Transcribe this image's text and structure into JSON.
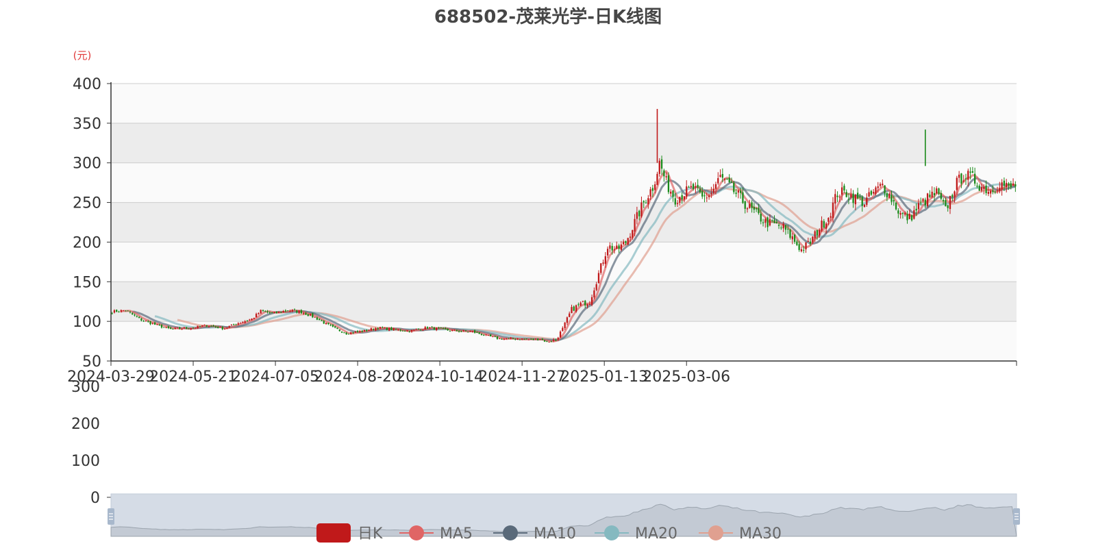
{
  "chart_data": {
    "type": "candlestick",
    "title": "688502-茂莱光学-日K线图",
    "y_unit": "(元)",
    "ylim": [
      50,
      400
    ],
    "y_ticks": [
      400,
      350,
      300,
      250,
      200,
      150,
      100,
      50
    ],
    "x_tick_labels": [
      "2024-03-29",
      "2024-05-21",
      "2024-07-05",
      "2024-08-20",
      "2024-10-14",
      "2024-11-27",
      "2025-01-13",
      "2025-03-06"
    ],
    "volume_ticks": [
      300,
      200,
      100,
      0
    ],
    "legend": [
      "日K",
      "MA5",
      "MA10",
      "MA20",
      "MA30"
    ],
    "colors": {
      "up": "#c0191a",
      "down": "#1a8a1a",
      "ma5": "#e06565",
      "ma10": "#5a6a7a",
      "ma20": "#85b9c0",
      "ma30": "#e0a090",
      "grid_band": "#ececec",
      "zoom_fill": "#d5dce6",
      "zoom_handle": "#a8b8cc"
    },
    "close_trend": [
      [
        0,
        112
      ],
      [
        6,
        114
      ],
      [
        12,
        103
      ],
      [
        20,
        95
      ],
      [
        26,
        90
      ],
      [
        36,
        92
      ],
      [
        42,
        95
      ],
      [
        50,
        91
      ],
      [
        56,
        98
      ],
      [
        62,
        103
      ],
      [
        66,
        113
      ],
      [
        72,
        110
      ],
      [
        78,
        114
      ],
      [
        84,
        112
      ],
      [
        90,
        105
      ],
      [
        98,
        92
      ],
      [
        104,
        85
      ],
      [
        112,
        88
      ],
      [
        118,
        92
      ],
      [
        124,
        90
      ],
      [
        132,
        88
      ],
      [
        140,
        92
      ],
      [
        146,
        90
      ],
      [
        152,
        88
      ],
      [
        160,
        87
      ],
      [
        166,
        82
      ],
      [
        172,
        78
      ],
      [
        180,
        78
      ],
      [
        186,
        77
      ],
      [
        190,
        78
      ],
      [
        193,
        74
      ],
      [
        197,
        77
      ],
      [
        200,
        90
      ],
      [
        204,
        115
      ],
      [
        208,
        122
      ],
      [
        212,
        125
      ],
      [
        216,
        160
      ],
      [
        220,
        195
      ],
      [
        224,
        190
      ],
      [
        228,
        200
      ],
      [
        232,
        225
      ],
      [
        236,
        250
      ],
      [
        240,
        270
      ],
      [
        243,
        300
      ],
      [
        246,
        275
      ],
      [
        250,
        255
      ],
      [
        254,
        262
      ],
      [
        258,
        268
      ],
      [
        262,
        255
      ],
      [
        266,
        262
      ],
      [
        270,
        282
      ],
      [
        274,
        270
      ],
      [
        278,
        258
      ],
      [
        282,
        245
      ],
      [
        286,
        235
      ],
      [
        290,
        225
      ],
      [
        294,
        222
      ],
      [
        298,
        218
      ],
      [
        302,
        205
      ],
      [
        306,
        190
      ],
      [
        310,
        200
      ],
      [
        314,
        218
      ],
      [
        318,
        232
      ],
      [
        322,
        262
      ],
      [
        326,
        262
      ],
      [
        330,
        255
      ],
      [
        334,
        250
      ],
      [
        338,
        262
      ],
      [
        342,
        272
      ],
      [
        346,
        255
      ],
      [
        350,
        235
      ],
      [
        354,
        230
      ],
      [
        358,
        245
      ],
      [
        362,
        255
      ],
      [
        366,
        262
      ],
      [
        370,
        240
      ],
      [
        374,
        270
      ],
      [
        378,
        285
      ],
      [
        382,
        280
      ],
      [
        386,
        270
      ],
      [
        390,
        265
      ],
      [
        394,
        275
      ],
      [
        398,
        268
      ],
      [
        401,
        272
      ]
    ],
    "spikes": [
      {
        "x": 242,
        "high": 368,
        "low": 300
      },
      {
        "x": 361,
        "high": 342,
        "low": 296
      }
    ]
  }
}
